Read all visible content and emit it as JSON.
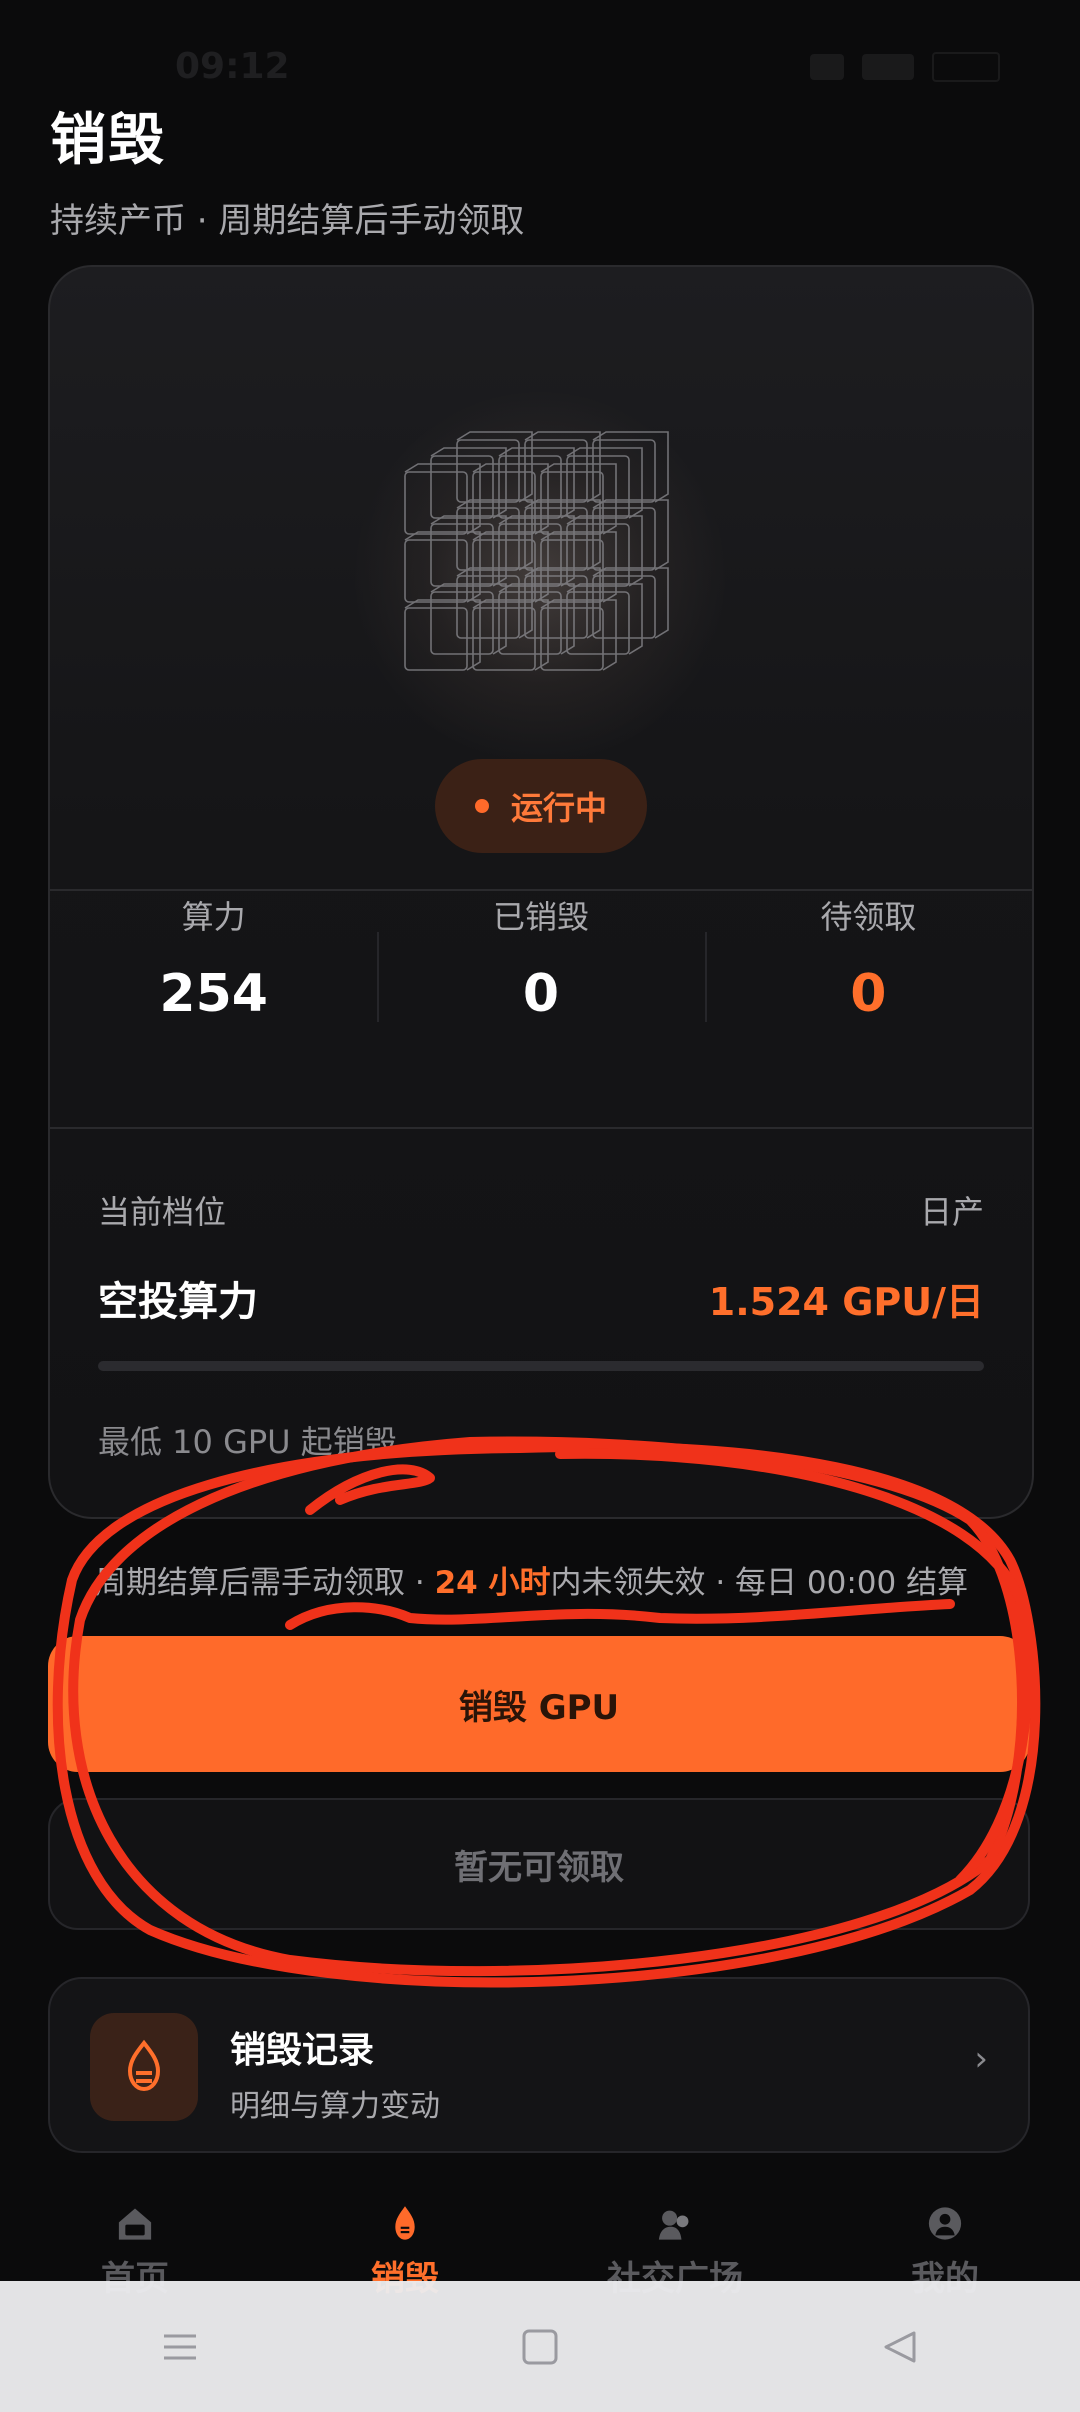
{
  "statusbar": {
    "time": "09:12"
  },
  "page": {
    "title": "销毁",
    "subtitle": "持续产币 · 周期结算后手动领取"
  },
  "card": {
    "status_label": "运行中",
    "stats": [
      {
        "label": "算力",
        "value": "254"
      },
      {
        "label": "已销毁",
        "value": "0"
      },
      {
        "label": "待领取",
        "value": "0"
      }
    ],
    "tier_label": "当前档位",
    "daily_label": "日产",
    "tier_name": "空投算力",
    "daily_value": "1.524 GPU/日",
    "progress": 0,
    "min_text": "最低 10 GPU 起销毁"
  },
  "notice": {
    "part1": "周期结算后需手动领取 · ",
    "highlight": "24 小时",
    "part2": "内未领失效 · 每日 00:00 结算"
  },
  "actions": {
    "burn_label": "销毁 GPU",
    "claim_label": "暂无可领取"
  },
  "record": {
    "title": "销毁记录",
    "subtitle": "明细与算力变动",
    "chevron": "›"
  },
  "tabs": [
    {
      "label": "首页",
      "icon": "home-icon",
      "active": false
    },
    {
      "label": "销毁",
      "icon": "flame-icon",
      "active": true
    },
    {
      "label": "社交广场",
      "icon": "social-icon",
      "active": false
    },
    {
      "label": "我的",
      "icon": "user-icon",
      "active": false
    }
  ],
  "colors": {
    "accent": "#ff6a2a",
    "background": "#0b0b0c",
    "annotation": "#f0321a"
  }
}
